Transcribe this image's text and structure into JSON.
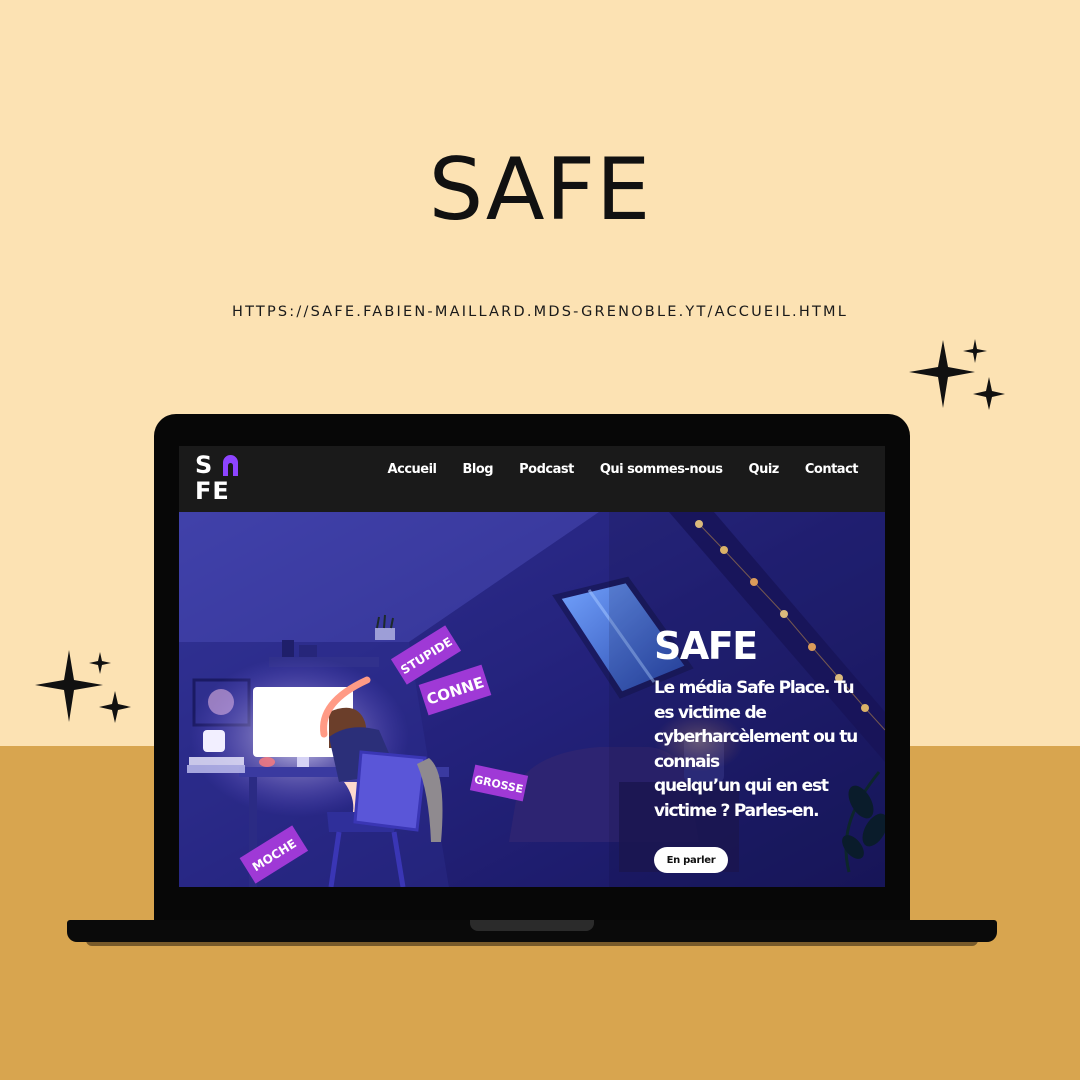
{
  "poster": {
    "title": "SAFE",
    "url": "HTTPS://SAFE.FABIEN-MAILLARD.MDS-GRENOBLE.YT/ACCUEIL.HTML"
  },
  "colors": {
    "cream": "#fce2b3",
    "mustard": "#d8a54f",
    "dark": "#1a1a1a",
    "accent_purple": "#8e44ff",
    "sticker_purple": "#9f39d6"
  },
  "site": {
    "logo": {
      "line1": "S",
      "line2": "FE"
    },
    "nav": [
      "Accueil",
      "Blog",
      "Podcast",
      "Qui sommes-nous",
      "Quiz",
      "Contact"
    ],
    "hero": {
      "title": "SAFE",
      "text_lines": [
        "Le média Safe Place. Tu",
        "es victime de",
        "cyberharcèlement ou tu",
        "connais",
        "quelqu’un qui en est",
        "victime ? Parles-en."
      ],
      "button": "En parler",
      "stickers": [
        "STUPIDE",
        "CONNE",
        "GROSSE",
        "MOCHE"
      ]
    }
  }
}
